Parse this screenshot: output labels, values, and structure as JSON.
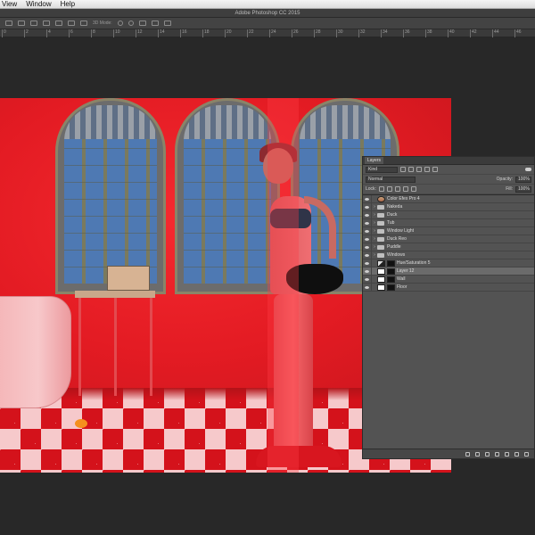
{
  "menubar": {
    "items": [
      "View",
      "Window",
      "Help"
    ]
  },
  "titlebar": {
    "title": "Adobe Photoshop CC 2015"
  },
  "optionsbar": {
    "mode_text": "3D Mode:"
  },
  "ruler": {
    "ticks": [
      "0",
      "2",
      "4",
      "6",
      "8",
      "10",
      "12",
      "14",
      "16",
      "18",
      "20",
      "22",
      "24",
      "26",
      "28",
      "30",
      "32",
      "34",
      "36",
      "38",
      "40",
      "42",
      "44",
      "46"
    ]
  },
  "layers_panel": {
    "tab_label": "Layers",
    "filter_kind": "Kind",
    "blend_mode": "Normal",
    "opacity_label": "Opacity:",
    "opacity_value": "100%",
    "lock_label": "Lock:",
    "fill_label": "Fill:",
    "fill_value": "100%",
    "layers": [
      {
        "name": "Color Efex Pro 4",
        "type": "photo",
        "visible": true
      },
      {
        "name": "Nakeda",
        "type": "group",
        "visible": true
      },
      {
        "name": "Duck",
        "type": "group",
        "visible": true
      },
      {
        "name": "Tub",
        "type": "group",
        "visible": true
      },
      {
        "name": "Window Light",
        "type": "group",
        "visible": true
      },
      {
        "name": "Duck Reo",
        "type": "group",
        "visible": true
      },
      {
        "name": "Puddle",
        "type": "group",
        "visible": true
      },
      {
        "name": "Windows",
        "type": "group",
        "visible": true
      },
      {
        "name": "Hue/Saturation 5",
        "type": "adjustment",
        "visible": true
      },
      {
        "name": "Layer 12",
        "type": "layer",
        "visible": true,
        "selected": true
      },
      {
        "name": "Wall",
        "type": "layer",
        "visible": true
      },
      {
        "name": "Floor",
        "type": "layer",
        "visible": true
      }
    ]
  },
  "colors": {
    "canvas_red": "#ee1a22",
    "panel_bg": "#535353",
    "app_bg": "#282828"
  }
}
